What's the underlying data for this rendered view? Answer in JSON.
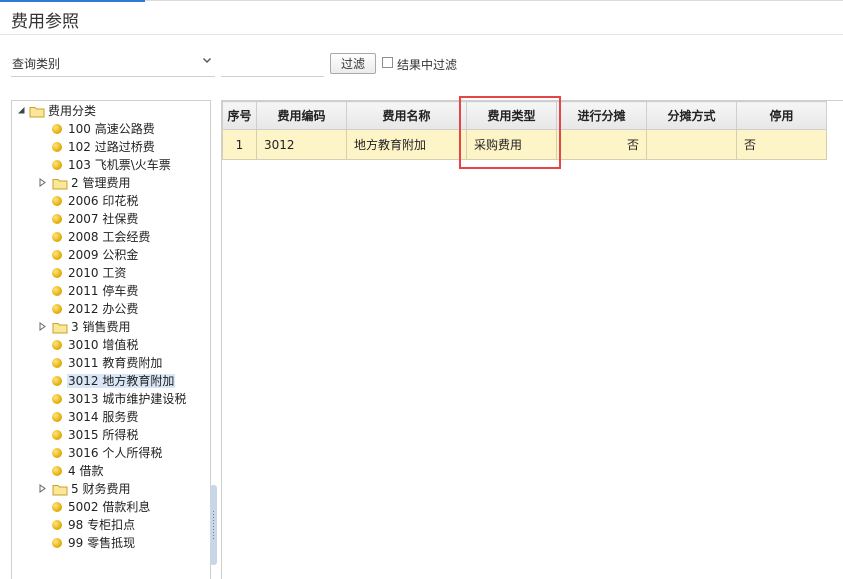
{
  "page": {
    "title": "费用参照"
  },
  "filter": {
    "category_value": "查询类别",
    "input_value": "",
    "filter_button": "过滤",
    "result_filter_label": "结果中过滤",
    "result_filter_checked": false
  },
  "tree": {
    "nodes": [
      {
        "label": "费用分类",
        "type": "folder",
        "level": 0,
        "expanded": true
      },
      {
        "label": "100 高速公路费",
        "type": "leaf",
        "level": 1
      },
      {
        "label": "102 过路过桥费",
        "type": "leaf",
        "level": 1
      },
      {
        "label": "103 飞机票\\火车票",
        "type": "leaf",
        "level": 1
      },
      {
        "label": "2 管理费用",
        "type": "folder",
        "level": 1,
        "expanded": false
      },
      {
        "label": "2006 印花税",
        "type": "leaf",
        "level": 1
      },
      {
        "label": "2007 社保费",
        "type": "leaf",
        "level": 1
      },
      {
        "label": "2008 工会经费",
        "type": "leaf",
        "level": 1
      },
      {
        "label": "2009 公积金",
        "type": "leaf",
        "level": 1
      },
      {
        "label": "2010 工资",
        "type": "leaf",
        "level": 1
      },
      {
        "label": "2011 停车费",
        "type": "leaf",
        "level": 1
      },
      {
        "label": "2012 办公费",
        "type": "leaf",
        "level": 1
      },
      {
        "label": "3 销售费用",
        "type": "folder",
        "level": 1,
        "expanded": false
      },
      {
        "label": "3010 增值税",
        "type": "leaf",
        "level": 1
      },
      {
        "label": "3011 教育费附加",
        "type": "leaf",
        "level": 1
      },
      {
        "label": "3012 地方教育附加",
        "type": "leaf",
        "level": 1,
        "selected": true
      },
      {
        "label": "3013 城市维护建设税",
        "type": "leaf",
        "level": 1
      },
      {
        "label": "3014 服务费",
        "type": "leaf",
        "level": 1
      },
      {
        "label": "3015 所得税",
        "type": "leaf",
        "level": 1
      },
      {
        "label": "3016 个人所得税",
        "type": "leaf",
        "level": 1
      },
      {
        "label": "4 借款",
        "type": "leaf",
        "level": 1
      },
      {
        "label": "5 财务费用",
        "type": "folder",
        "level": 1,
        "expanded": false
      },
      {
        "label": "5002 借款利息",
        "type": "leaf",
        "level": 1
      },
      {
        "label": "98 专柜扣点",
        "type": "leaf",
        "level": 1
      },
      {
        "label": "99 零售抵现",
        "type": "leaf",
        "level": 1
      }
    ]
  },
  "grid": {
    "columns": [
      "序号",
      "费用编码",
      "费用名称",
      "费用类型",
      "进行分摊",
      "分摊方式",
      "停用"
    ],
    "rows": [
      [
        "1",
        "3012",
        "地方教育附加",
        "采购费用",
        "否",
        "",
        "否"
      ]
    ]
  },
  "colors": {
    "accent": "#2f7ad6",
    "row_highlight": "#fdf4c7",
    "selection_box": "#e64545",
    "tree_selected": "#d8e6f6"
  }
}
